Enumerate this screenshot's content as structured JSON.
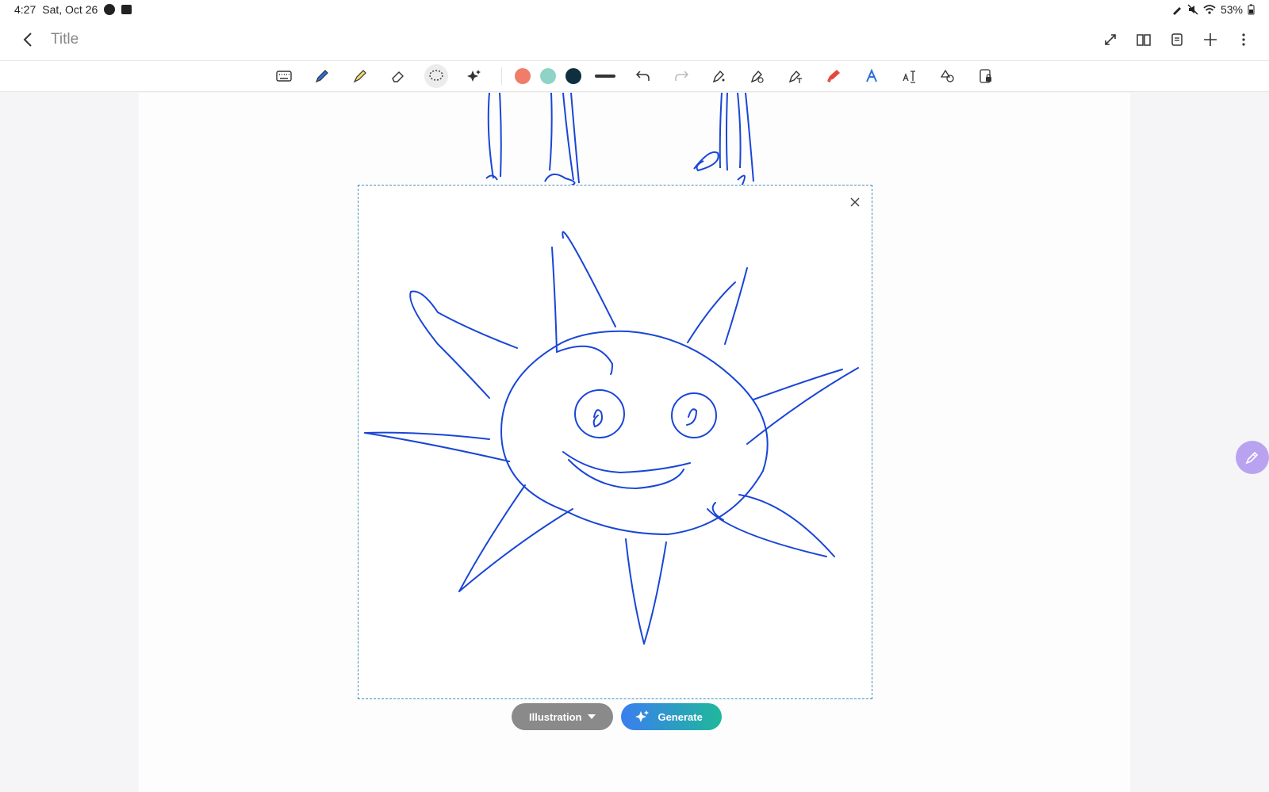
{
  "status": {
    "time": "4:27",
    "date": "Sat, Oct 26",
    "battery": "53%"
  },
  "header": {
    "title": "Title"
  },
  "toolbar": {
    "colors": {
      "orange": "#ef7d6a",
      "mint": "#8fd3c6",
      "dark": "#0f2f3f"
    },
    "accent_red": "#e6483f",
    "accent_blue": "#2b6fd6"
  },
  "canvas": {
    "stroke_color": "#1a46d6",
    "style_label": "Illustration",
    "generate_label": "Generate"
  }
}
